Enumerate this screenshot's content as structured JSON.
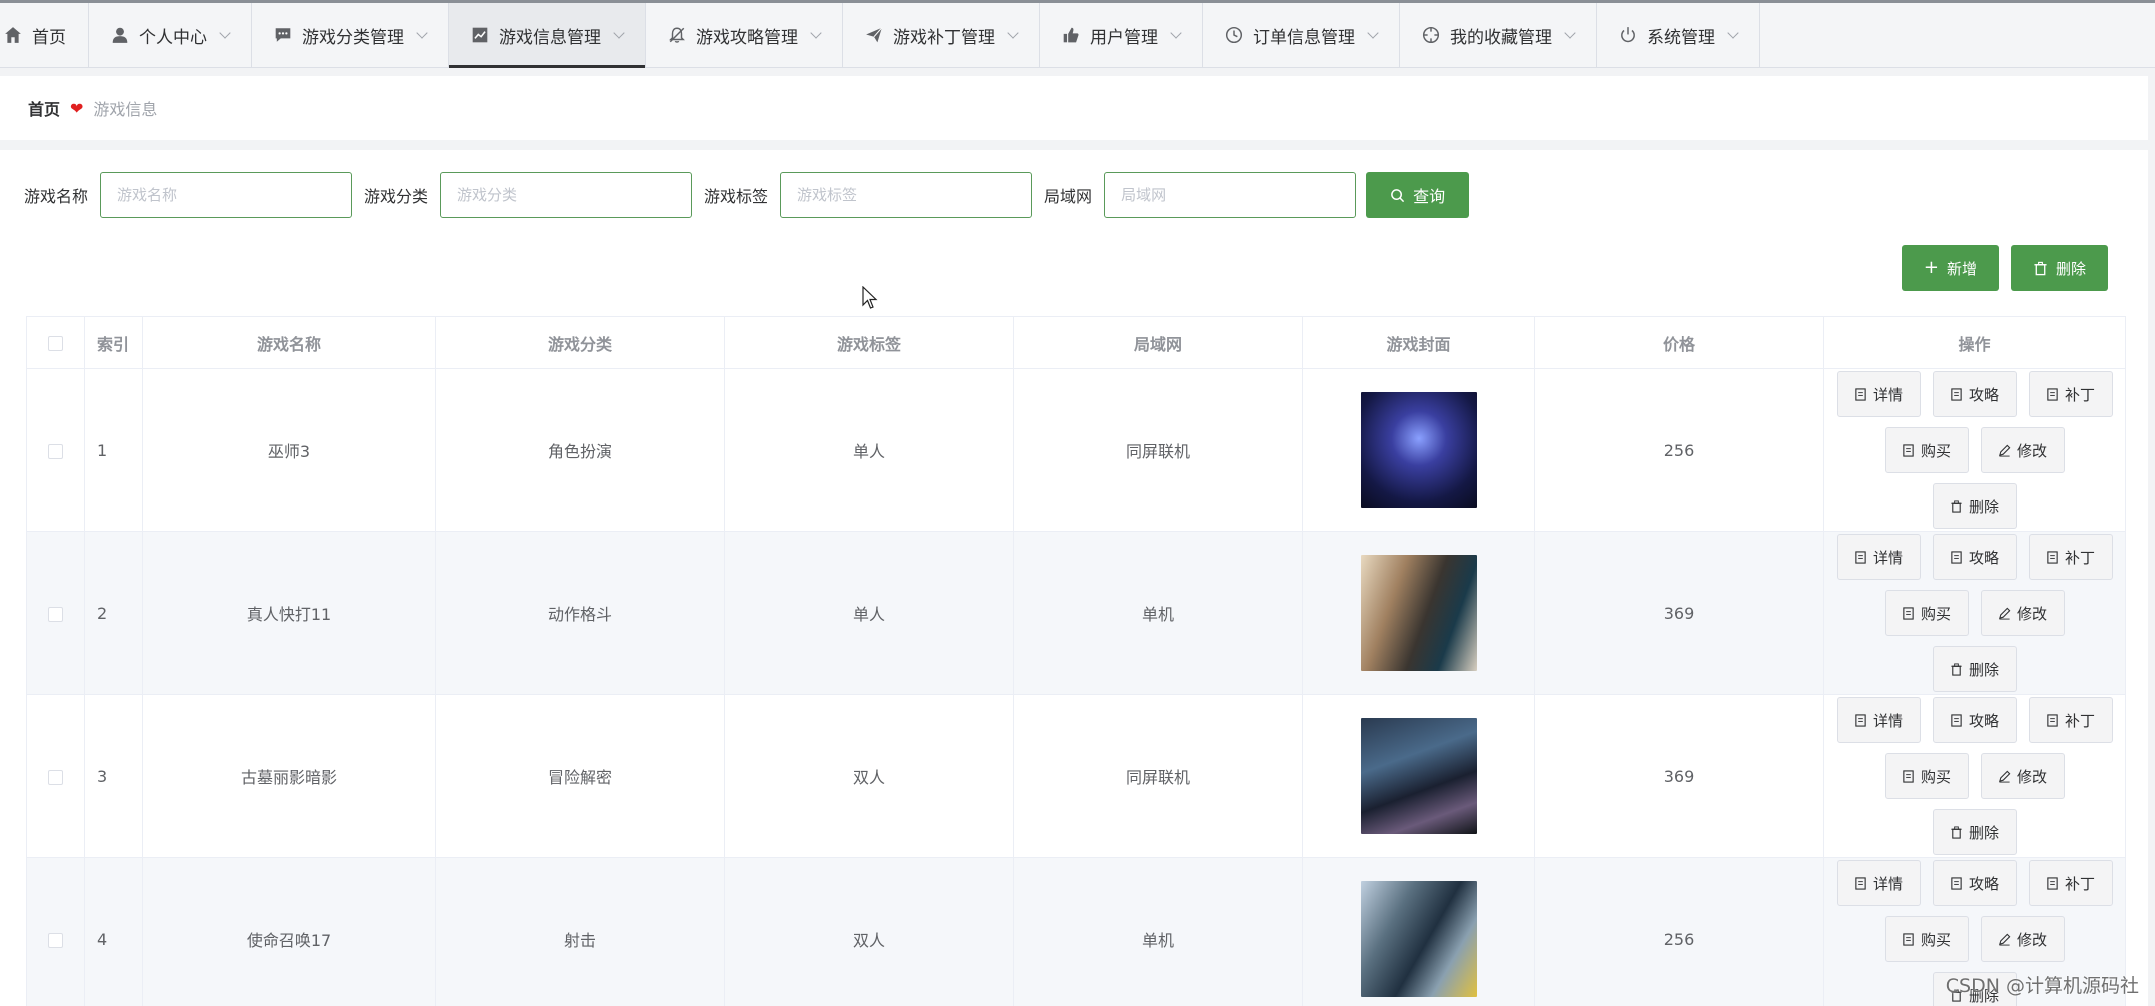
{
  "nav": {
    "items": [
      {
        "label": "首页",
        "icon": "home-icon",
        "has_dropdown": false,
        "active": false
      },
      {
        "label": "个人中心",
        "icon": "user-icon",
        "has_dropdown": true,
        "active": false
      },
      {
        "label": "游戏分类管理",
        "icon": "chat-icon",
        "has_dropdown": true,
        "active": false
      },
      {
        "label": "游戏信息管理",
        "icon": "chart-icon",
        "has_dropdown": true,
        "active": true
      },
      {
        "label": "游戏攻略管理",
        "icon": "bell-off-icon",
        "has_dropdown": true,
        "active": false
      },
      {
        "label": "游戏补丁管理",
        "icon": "send-icon",
        "has_dropdown": true,
        "active": false
      },
      {
        "label": "用户管理",
        "icon": "thumb-icon",
        "has_dropdown": true,
        "active": false
      },
      {
        "label": "订单信息管理",
        "icon": "clock-icon",
        "has_dropdown": true,
        "active": false
      },
      {
        "label": "我的收藏管理",
        "icon": "aim-icon",
        "has_dropdown": true,
        "active": false
      },
      {
        "label": "系统管理",
        "icon": "power-icon",
        "has_dropdown": true,
        "active": false
      }
    ]
  },
  "breadcrumb": {
    "home": "首页",
    "separator_icon": "heart-icon",
    "current": "游戏信息"
  },
  "search": {
    "fields": [
      {
        "label": "游戏名称",
        "placeholder": "游戏名称",
        "value": ""
      },
      {
        "label": "游戏分类",
        "placeholder": "游戏分类",
        "value": ""
      },
      {
        "label": "游戏标签",
        "placeholder": "游戏标签",
        "value": ""
      },
      {
        "label": "局域网",
        "placeholder": "局域网",
        "value": ""
      }
    ],
    "button": "查询"
  },
  "toolbar": {
    "add": "新增",
    "delete": "删除"
  },
  "table": {
    "headers": [
      "索引",
      "游戏名称",
      "游戏分类",
      "游戏标签",
      "局域网",
      "游戏封面",
      "价格",
      "操作"
    ],
    "rows": [
      {
        "index": "1",
        "name": "巫师3",
        "category": "角色扮演",
        "tag": "单人",
        "lan": "同屏联机",
        "price": "256"
      },
      {
        "index": "2",
        "name": "真人快打11",
        "category": "动作格斗",
        "tag": "单人",
        "lan": "单机",
        "price": "369"
      },
      {
        "index": "3",
        "name": "古墓丽影暗影",
        "category": "冒险解密",
        "tag": "双人",
        "lan": "同屏联机",
        "price": "369"
      },
      {
        "index": "4",
        "name": "使命召唤17",
        "category": "射击",
        "tag": "双人",
        "lan": "单机",
        "price": "256"
      }
    ],
    "row_actions": {
      "detail": "详情",
      "guide": "攻略",
      "patch": "补丁",
      "buy": "购买",
      "edit": "修改",
      "delete": "删除"
    }
  },
  "watermark": "CSDN @计算机源码社",
  "colors": {
    "primary": "#4c9a4c",
    "heart": "#e02020",
    "active_underline": "#303133"
  }
}
